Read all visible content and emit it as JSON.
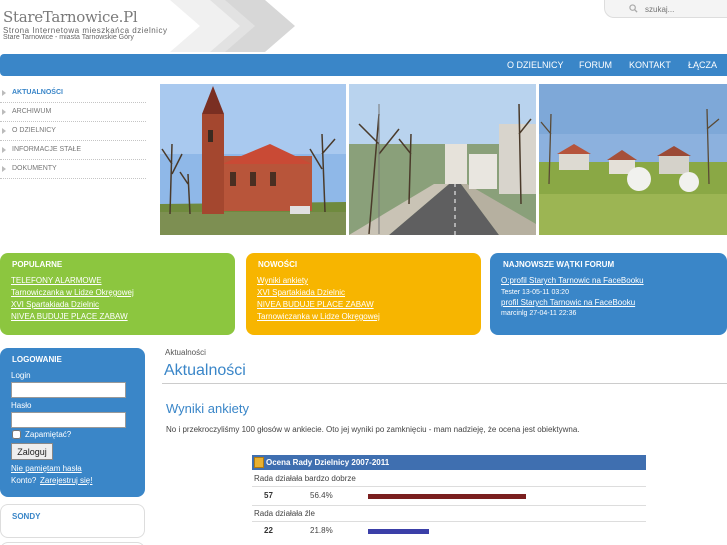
{
  "header": {
    "site_title": "StareTarnowice.Pl",
    "subtitle_1": "Strona Internetowa mieszkańca dzielnicy",
    "subtitle_2": "Stare Tarnowice - miasta Tarnowskie Góry",
    "search_placeholder": "szukaj..."
  },
  "topnav": {
    "items": [
      {
        "label": "O DZIELNICY"
      },
      {
        "label": "FORUM"
      },
      {
        "label": "KONTAKT"
      },
      {
        "label": "ŁĄCZA"
      }
    ]
  },
  "sidemenu": {
    "items": [
      {
        "label": "AKTUALNOŚCI",
        "active": true
      },
      {
        "label": "ARCHIWUM"
      },
      {
        "label": "O DZIELNICY"
      },
      {
        "label": "INFORMACJE STAŁE"
      },
      {
        "label": "DOKUMENTY"
      }
    ]
  },
  "boxes": {
    "popularne": {
      "title": "POPULARNE",
      "color": "#8cc63f",
      "links": [
        "TELEFONY ALARMOWE",
        "Tarnowiczanka w Lidze Okręgowej",
        "XVI Spartakiada Dzielnic",
        "NIVEA BUDUJE PLACE ZABAW"
      ]
    },
    "nowosci": {
      "title": "NOWOŚCI",
      "color": "#f7b500",
      "links": [
        "Wyniki ankiety",
        "XVI Spartakiada Dzielnic",
        "NIVEA BUDUJE PLACE ZABAW",
        "Tarnowiczanka w Lidze Okręgowej"
      ]
    },
    "forum": {
      "title": "NAJNOWSZE WĄTKI FORUM",
      "color": "#3a86c8",
      "link_1": "O:profil Starych Tarnowic na FaceBooku",
      "meta_1": "Tester 13-05-11 03:20",
      "link_2": "profil Starych Tarnowic na FaceBooku",
      "meta_2": "marcinlg 27-04-11 22:36"
    }
  },
  "login": {
    "title": "LOGOWANIE",
    "login_label": "Login",
    "password_label": "Hasło",
    "remember_label": "Zapamiętać?",
    "submit_label": "Zaloguj",
    "forgot_label": "Nie pamiętam hasła",
    "account_prefix": "Konto?",
    "register_label": "Zarejestruj się!"
  },
  "sondy": {
    "title": "SONDY"
  },
  "content": {
    "breadcrumb": "Aktualności",
    "page_title": "Aktualności",
    "article_title": "Wyniki ankiety",
    "article_text": "No i przekroczyliśmy 100 głosów w ankiecie. Oto jej wyniki po zamknięciu - mam nadzieję, że ocena jest obiektywna."
  },
  "poll": {
    "title": "Ocena Rady Dzielnicy 2007-2011",
    "rows": [
      {
        "question": "Rada działała bardzo dobrze",
        "votes": "57",
        "percent": "56.4%",
        "fraction": 0.564,
        "color": "#7a1f1f"
      },
      {
        "question": "Rada działała źle",
        "votes": "22",
        "percent": "21.8%",
        "fraction": 0.218,
        "color": "#3b3fa8"
      }
    ]
  },
  "colors": {
    "accent": "#3a86c8",
    "green": "#8cc63f",
    "yellow": "#f7b500"
  }
}
